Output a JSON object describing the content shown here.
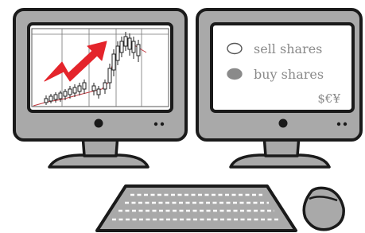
{
  "right_screen": {
    "options": [
      {
        "label": "sell shares",
        "selected": false
      },
      {
        "label": "buy shares",
        "selected": true
      }
    ],
    "currency_text": "$€¥"
  },
  "colors": {
    "outline": "#1a1a1a",
    "monitor_body": "#a9a9a9",
    "screen_bg": "#ffffff",
    "arrow": "#e4242b",
    "candle_line": "#c23a40",
    "text_gray": "#8a8a8a"
  }
}
